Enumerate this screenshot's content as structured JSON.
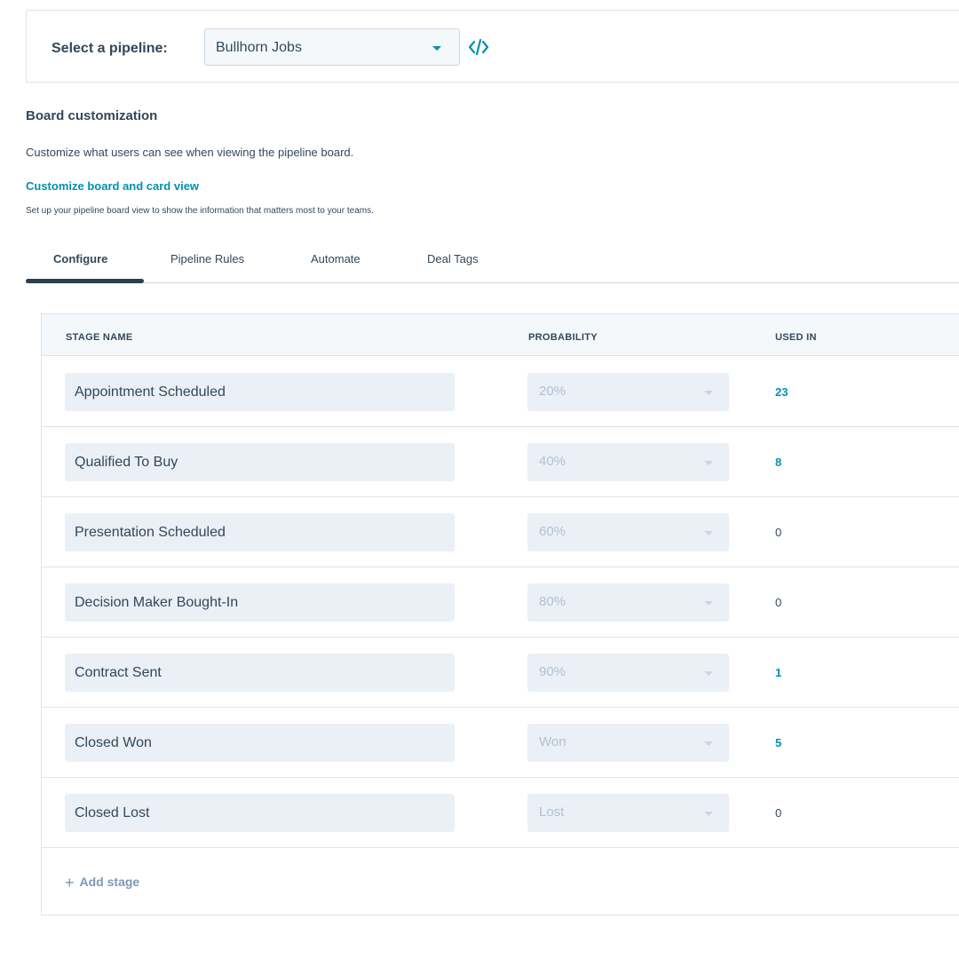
{
  "pipeline": {
    "label": "Select a pipeline:",
    "selected": "Bullhorn Jobs",
    "code_icon": "code-icon"
  },
  "board": {
    "title": "Board customization",
    "description": "Customize what users can see when viewing the pipeline board.",
    "link": "Customize board and card view",
    "link_description": "Set up your pipeline board view to show the information that matters most to your teams."
  },
  "tabs": [
    {
      "label": "Configure",
      "active": true
    },
    {
      "label": "Pipeline Rules",
      "active": false
    },
    {
      "label": "Automate",
      "active": false
    },
    {
      "label": "Deal Tags",
      "active": false
    }
  ],
  "table": {
    "headers": {
      "stage_name": "STAGE NAME",
      "probability": "PROBABILITY",
      "used_in": "USED IN"
    },
    "rows": [
      {
        "stage": "Appointment Scheduled",
        "probability": "20%",
        "used_in": "23"
      },
      {
        "stage": "Qualified To Buy",
        "probability": "40%",
        "used_in": "8"
      },
      {
        "stage": "Presentation Scheduled",
        "probability": "60%",
        "used_in": "0"
      },
      {
        "stage": "Decision Maker Bought-In",
        "probability": "80%",
        "used_in": "0"
      },
      {
        "stage": "Contract Sent",
        "probability": "90%",
        "used_in": "1"
      },
      {
        "stage": "Closed Won",
        "probability": "Won",
        "used_in": "5"
      },
      {
        "stage": "Closed Lost",
        "probability": "Lost",
        "used_in": "0"
      }
    ],
    "add_stage": "Add stage"
  },
  "colors": {
    "accent": "#0091ae",
    "text": "#33475b",
    "input_bg": "#eaf0f6"
  }
}
